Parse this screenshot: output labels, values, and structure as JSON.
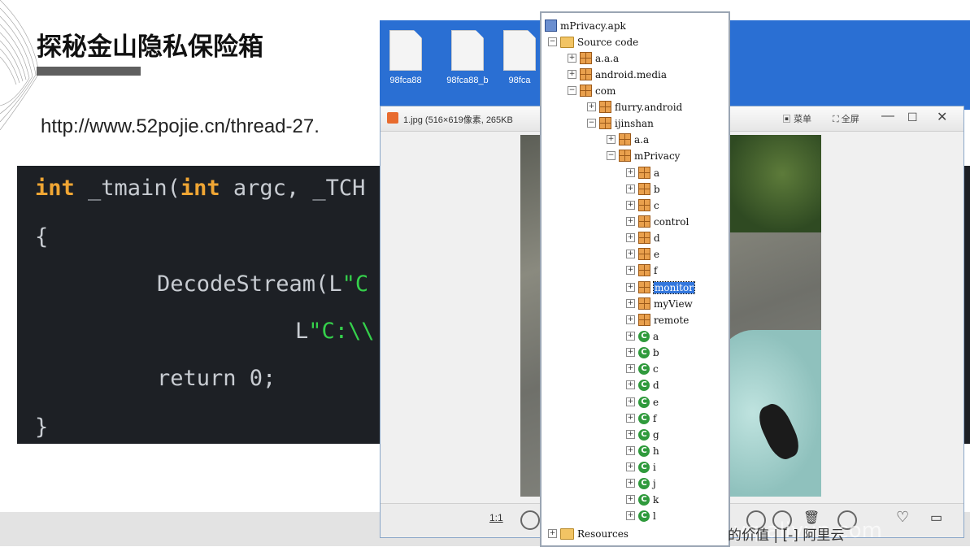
{
  "slide": {
    "title": "探秘金山隐私保险箱",
    "url": "http://www.52pojie.cn/thread-27.",
    "footer_text": "的价值 | [-] 阿里云",
    "watermark": "云栖社区 yq.aliyun.com"
  },
  "code": {
    "line1": {
      "kw1": "int",
      "t1": " _tmain(",
      "kw2": "int",
      "t2": " argc, _TCH"
    },
    "line2": "{",
    "line3": {
      "t": "DecodeStream(L",
      "s": "\"C"
    },
    "line4": {
      "t": "L",
      "s": "\"C:\\\\"
    },
    "line5": "return 0;",
    "line6": "}"
  },
  "desktop": {
    "icons": [
      "98fca88",
      "98fca88_b",
      "98fca"
    ]
  },
  "viewer": {
    "title": "1.jpg (516×619像素, 265KB",
    "menu_label": "菜单",
    "fullscreen_label": "全屏",
    "zoom_label": "1:1"
  },
  "tree": {
    "root": "mPrivacy.apk",
    "source": "Source code",
    "nodes": {
      "aaa": "a.a.a",
      "media": "android.media",
      "com": "com",
      "flurry": "flurry.android",
      "ijinshan": "ijinshan",
      "aa": "a.a",
      "mprivacy": "mPrivacy",
      "pkg_a": "a",
      "pkg_b": "b",
      "pkg_c": "c",
      "pkg_control": "control",
      "pkg_d": "d",
      "pkg_e": "e",
      "pkg_f": "f",
      "pkg_monitor": "monitor",
      "pkg_myview": "myView",
      "pkg_remote": "remote",
      "cls_a": "a",
      "cls_b": "b",
      "cls_c": "c",
      "cls_d": "d",
      "cls_e": "e",
      "cls_f": "f",
      "cls_g": "g",
      "cls_h": "h",
      "cls_i": "i",
      "cls_j": "j",
      "cls_k": "k",
      "cls_l": "l"
    },
    "resources": "Resources"
  }
}
